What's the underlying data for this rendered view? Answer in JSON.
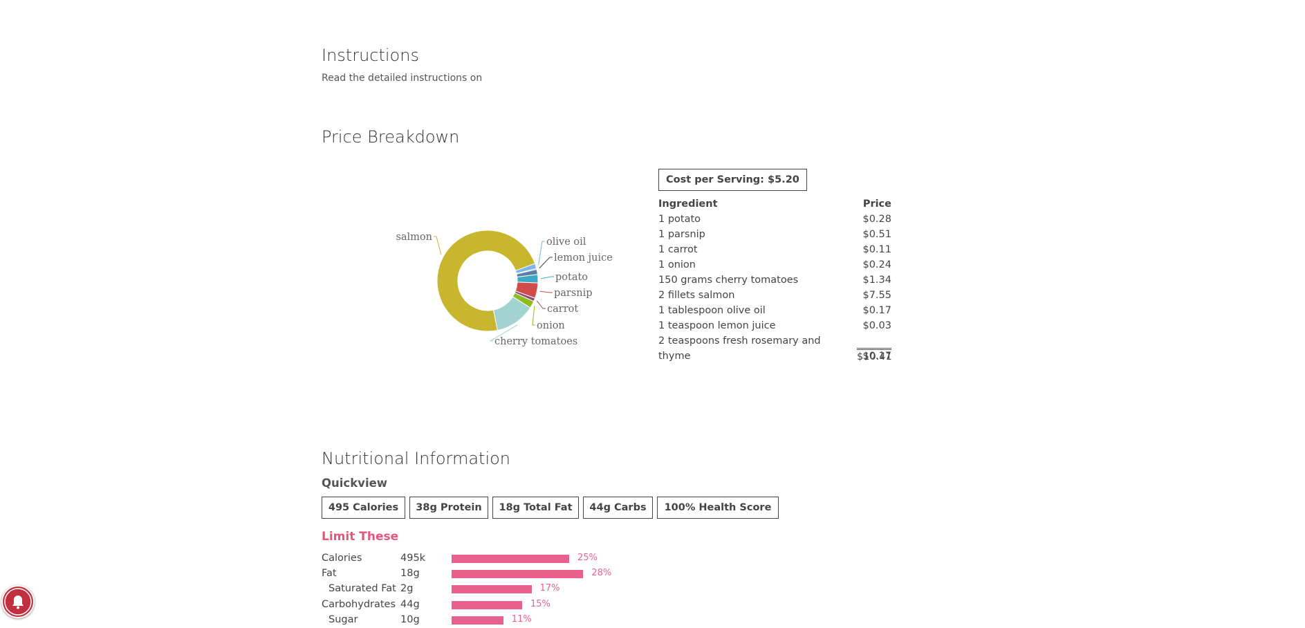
{
  "instructions": {
    "title": "Instructions",
    "text": "Read the detailed instructions on"
  },
  "price": {
    "title": "Price Breakdown",
    "cost_per_serving": "Cost per Serving: $5.20",
    "headers": {
      "ingredient": "Ingredient",
      "price": "Price"
    },
    "rows": [
      {
        "ingredient": "1 potato",
        "price": "$0.28"
      },
      {
        "ingredient": "1 parsnip",
        "price": "$0.51"
      },
      {
        "ingredient": "1 carrot",
        "price": "$0.11"
      },
      {
        "ingredient": "1 onion",
        "price": "$0.24"
      },
      {
        "ingredient": "150 grams cherry tomatoes",
        "price": "$1.34"
      },
      {
        "ingredient": "2 fillets salmon",
        "price": "$7.55"
      },
      {
        "ingredient": "1 tablespoon olive oil",
        "price": "$0.17"
      },
      {
        "ingredient": "1 teaspoon lemon juice",
        "price": "$0.03"
      },
      {
        "ingredient": "2 teaspoons fresh rosemary and thyme",
        "price": "$0.17"
      }
    ],
    "total": "$10.41"
  },
  "chart_data": {
    "type": "pie",
    "donut": true,
    "slices": [
      {
        "label": "olive oil",
        "value": 0.17,
        "color": "#7cb5ec"
      },
      {
        "label": "lemon juice",
        "value": 0.03,
        "color": "#434348"
      },
      {
        "label": "",
        "value": 0.17,
        "color": "#5a7fa8"
      },
      {
        "label": "potato",
        "value": 0.28,
        "color": "#3fa9c4"
      },
      {
        "label": "parsnip",
        "value": 0.51,
        "color": "#d24b4b"
      },
      {
        "label": "carrot",
        "value": 0.11,
        "color": "#8e4a7a"
      },
      {
        "label": "onion",
        "value": 0.24,
        "color": "#8bbd1f"
      },
      {
        "label": "cherry tomatoes",
        "value": 1.34,
        "color": "#a3d3d0"
      },
      {
        "label": "salmon",
        "value": 7.55,
        "color": "#c8b62e"
      }
    ]
  },
  "nutrition": {
    "title": "Nutritional Information",
    "quickview_title": "Quickview",
    "quickview": [
      "495 Calories",
      "38g Protein",
      "18g Total Fat",
      "44g Carbs",
      "100% Health Score"
    ],
    "limit_title": "Limit These",
    "limit_rows": [
      {
        "label": "Calories",
        "amount": "495k",
        "percent": 25,
        "percent_label": "25%"
      },
      {
        "label": "Fat",
        "amount": "18g",
        "percent": 28,
        "percent_label": "28%"
      },
      {
        "label": "Saturated Fat",
        "amount": "2g",
        "percent": 17,
        "percent_label": "17%",
        "indent": true
      },
      {
        "label": "Carbohydrates",
        "amount": "44g",
        "percent": 15,
        "percent_label": "15%"
      },
      {
        "label": "Sugar",
        "amount": "10g",
        "percent": 11,
        "percent_label": "11%",
        "indent": true
      }
    ]
  },
  "notification": {
    "icon": "bell-icon"
  }
}
